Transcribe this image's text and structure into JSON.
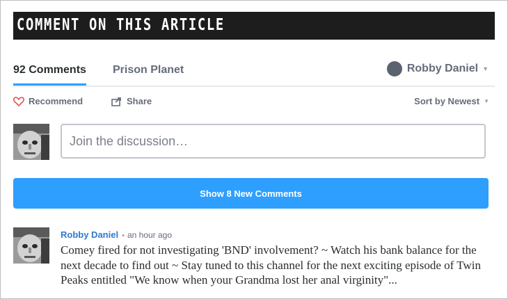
{
  "banner": {
    "title": "COMMENT ON THIS ARTICLE"
  },
  "tabs": {
    "comments_label": "92 Comments",
    "site_label": "Prison Planet",
    "user_name": "Robby Daniel"
  },
  "actions": {
    "recommend_label": "Recommend",
    "share_label": "Share",
    "sort_label": "Sort by Newest"
  },
  "composer": {
    "placeholder": "Join the discussion…"
  },
  "new_comments_button": "Show 8 New Comments",
  "comments": [
    {
      "author": "Robby Daniel",
      "separator": "•",
      "time": "an hour ago",
      "text": "Comey fired for not investigating 'BND' involvement? ~ Watch his bank balance for the next decade to find out ~ Stay tuned to this channel for the next exciting episode of Twin Peaks entitled \"We know when your Grandma lost her anal virginity\"..."
    }
  ],
  "colors": {
    "accent": "#2e9fff",
    "link": "#2e7ad1",
    "banner_bg": "#1e1d1d",
    "heart": "#e0565b"
  },
  "icons": [
    "heart-icon",
    "share-icon",
    "user-avatar-icon",
    "chevron-down-icon"
  ]
}
